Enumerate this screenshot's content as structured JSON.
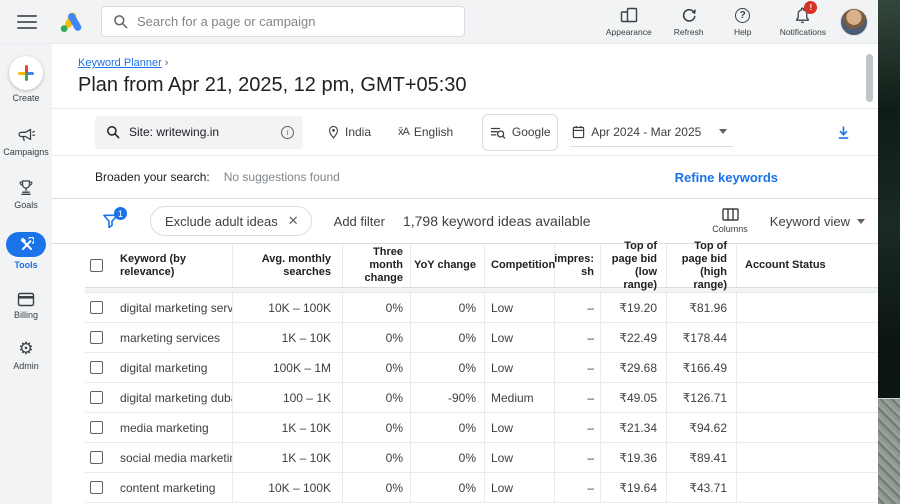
{
  "topbar": {
    "search_placeholder": "Search for a page or campaign",
    "actions": {
      "appearance": "Appearance",
      "refresh": "Refresh",
      "help": "Help",
      "notifications": "Notifications",
      "notification_badge": "!"
    }
  },
  "icons": {
    "help_glyph": "?",
    "info_glyph": "i",
    "translate_glyph": "x̄A",
    "gear_glyph": "⚙",
    "chevron_right": "›",
    "close_glyph": "✕"
  },
  "sidebar": {
    "items": [
      {
        "label": "Create"
      },
      {
        "label": "Campaigns"
      },
      {
        "label": "Goals"
      },
      {
        "label": "Tools"
      },
      {
        "label": "Billing"
      },
      {
        "label": "Admin"
      }
    ],
    "active": "Tools"
  },
  "breadcrumb": {
    "link": "Keyword Planner"
  },
  "page_title": "Plan from Apr 21, 2025, 12 pm, GMT+05:30",
  "filters": {
    "site": "Site: writewing.in",
    "location": "India",
    "language": "English",
    "network": "Google",
    "date_range": "Apr 2024 - Mar 2025"
  },
  "broaden": {
    "label": "Broaden your search:",
    "value": "No suggestions found",
    "refine_link": "Refine keywords"
  },
  "toolbar": {
    "filter_badge": "1",
    "chip_label": "Exclude adult ideas",
    "add_filter_label": "Add filter",
    "ideas_count": "1,798 keyword ideas available",
    "columns_label": "Columns",
    "view_label": "Keyword view"
  },
  "colors": {
    "accent": "#1a73e8",
    "badge_red": "#d93025"
  },
  "table": {
    "headers": {
      "keyword": "Keyword (by relevance)",
      "avg": "Avg. monthly searches",
      "three_month": "Three month change",
      "yoy": "YoY change",
      "competition": "Competition",
      "impr": "impres: sh",
      "bid_low": "Top of page bid (low range)",
      "bid_high": "Top of page bid (high range)",
      "account": "Account Status"
    },
    "rows": [
      {
        "keyword": "digital marketing services",
        "avg": "10K – 100K",
        "three_month": "0%",
        "yoy": "0%",
        "competition": "Low",
        "impr": "–",
        "bid_low": "₹19.20",
        "bid_high": "₹81.96",
        "account": ""
      },
      {
        "keyword": "marketing services",
        "avg": "1K – 10K",
        "three_month": "0%",
        "yoy": "0%",
        "competition": "Low",
        "impr": "–",
        "bid_low": "₹22.49",
        "bid_high": "₹178.44",
        "account": ""
      },
      {
        "keyword": "digital marketing",
        "avg": "100K – 1M",
        "three_month": "0%",
        "yoy": "0%",
        "competition": "Low",
        "impr": "–",
        "bid_low": "₹29.68",
        "bid_high": "₹166.49",
        "account": ""
      },
      {
        "keyword": "digital marketing dubai",
        "avg": "100 – 1K",
        "three_month": "0%",
        "yoy": "-90%",
        "competition": "Medium",
        "impr": "–",
        "bid_low": "₹49.05",
        "bid_high": "₹126.71",
        "account": ""
      },
      {
        "keyword": "media marketing",
        "avg": "1K – 10K",
        "three_month": "0%",
        "yoy": "0%",
        "competition": "Low",
        "impr": "–",
        "bid_low": "₹21.34",
        "bid_high": "₹94.62",
        "account": ""
      },
      {
        "keyword": "social media marketing s…",
        "avg": "1K – 10K",
        "three_month": "0%",
        "yoy": "0%",
        "competition": "Low",
        "impr": "–",
        "bid_low": "₹19.36",
        "bid_high": "₹89.41",
        "account": ""
      },
      {
        "keyword": "content marketing",
        "avg": "10K – 100K",
        "three_month": "0%",
        "yoy": "0%",
        "competition": "Low",
        "impr": "–",
        "bid_low": "₹19.64",
        "bid_high": "₹43.71",
        "account": ""
      }
    ]
  }
}
